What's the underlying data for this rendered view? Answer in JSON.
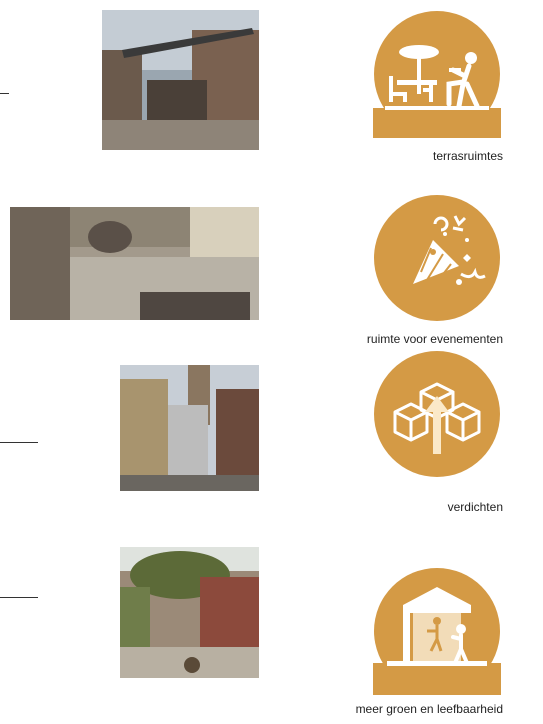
{
  "accent_color": "#d49a45",
  "features": [
    {
      "caption": "terrasruimtes",
      "icon": "terrace-waiter-icon",
      "photo": "terrace-street-photo"
    },
    {
      "caption": "ruimte voor evenementen",
      "icon": "party-popper-icon",
      "photo": "event-square-photo"
    },
    {
      "caption": "verdichten",
      "icon": "densify-blocks-icon",
      "photo": "densified-street-photo"
    },
    {
      "caption": "meer groen en leefbaarheid",
      "icon": "pavilion-people-icon",
      "photo": "green-alley-photo"
    }
  ]
}
